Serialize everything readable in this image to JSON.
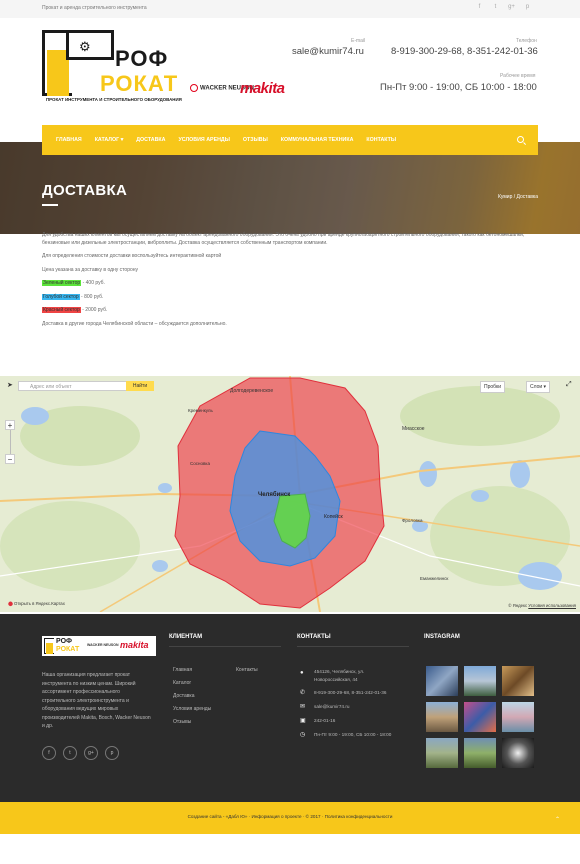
{
  "topbar": {
    "tagline": "Прокат и аренда строительного инструмента",
    "social": [
      "f",
      "t",
      "g+",
      "p"
    ]
  },
  "header": {
    "brand_top": "РОФ",
    "brand_bottom": "РОКАТ",
    "brand_sub": "ПРОКАТ ИНСТРУМЕНТА И СТРОИТЕЛЬНОГО ОБОРУДОВАНИЯ",
    "partner_1": "WACKER NEUSON",
    "partner_2": "makita",
    "email_label": "E-mail",
    "email": "sale@kumir74.ru",
    "phone_label": "Телефон",
    "phone": "8-919-300-29-68, 8-351-242-01-36",
    "hours_label": "Рабочее время",
    "hours": "Пн-Пт 9:00 - 19:00, СБ 10:00 - 18:00"
  },
  "nav": {
    "items": [
      "ГЛАВНАЯ",
      "КАТАЛОГ ▾",
      "ДОСТАВКА",
      "УСЛОВИЯ АРЕНДЫ",
      "ОТЗЫВЫ",
      "КОММУНАЛЬНАЯ ТЕХНИКА",
      "КОНТАКТЫ"
    ]
  },
  "hero": {
    "title": "ДОСТАВКА",
    "breadcrumb": "Кумир / Доставка"
  },
  "content": {
    "intro": "Для удобства наших клиентов мы осуществляем доставку на объект арендованного оборудования. Это очень удобно при аренде крупногабаритного строительного оборудования, такого как бетономешалки, бензиновые или дизельные электростанции, виброплиты. Доставка осуществляется собственным транспортом компании.",
    "map_hint": "Для определения стоимости доставки воспользуйтесь интерактивной картой",
    "price_note": "Цена указана за доставку в одну сторону",
    "zones": [
      {
        "label": "Зеленый сектор",
        "price": " - 400 руб.",
        "color": "#5be33a"
      },
      {
        "label": "Голубой сектор",
        "price": " - 800 руб.",
        "color": "#37b6f0"
      },
      {
        "label": "Красный сектор",
        "price": " - 2000 руб.",
        "color": "#ef4444"
      }
    ],
    "outside": "Доставка в другие города Челябинской области – обсуждается дополнительно."
  },
  "map": {
    "search_placeholder": "Адрес или объект",
    "search_button": "Найти",
    "traffic": "Пробки",
    "layers": "Слои ▾",
    "zoom_in": "+",
    "zoom_out": "−",
    "open_link": "Открыть в Яндекс.Картах",
    "copyright": "© Яндекс ",
    "terms": "Условия использования",
    "places": [
      "Долгодеревенское",
      "Миасское",
      "Челябинск",
      "Копейск",
      "Сосновка",
      "Кременкуль",
      "Фроловка",
      "Еманжелинск"
    ]
  },
  "footer": {
    "about": "Наша организация предлагает прокат инструмента по низким ценам. Широкий ассортимент профессионального строительного электроинструмента и оборудования ведущих мировых производителей Makita, Bosch, Wacker Neuson и др.",
    "social": [
      "f",
      "t",
      "g+",
      "p"
    ],
    "clients_title": "КЛИЕНТАМ",
    "clients_col1": [
      "Главная",
      "Каталог",
      "Доставка",
      "Условия аренды",
      "Отзывы"
    ],
    "clients_col2": [
      "Контакты"
    ],
    "contacts_title": "КОНТАКТЫ",
    "address_1": "454126, Челябинск, ул.",
    "address_2": "Новороссийская, 44",
    "phone": "8-919-300-29-68, 8-351-242-01-36",
    "email": "sale@kumir74.ru",
    "fax": "242-01-16",
    "hours": "Пн-Пт 9:00 - 19:00, СБ 10:00 - 18:00",
    "instagram_title": "INSTAGRAM",
    "credits": "Создание сайта - «Дабл Ю» · Информация о проекте · © 2017 · Политика конфиденциальности"
  }
}
